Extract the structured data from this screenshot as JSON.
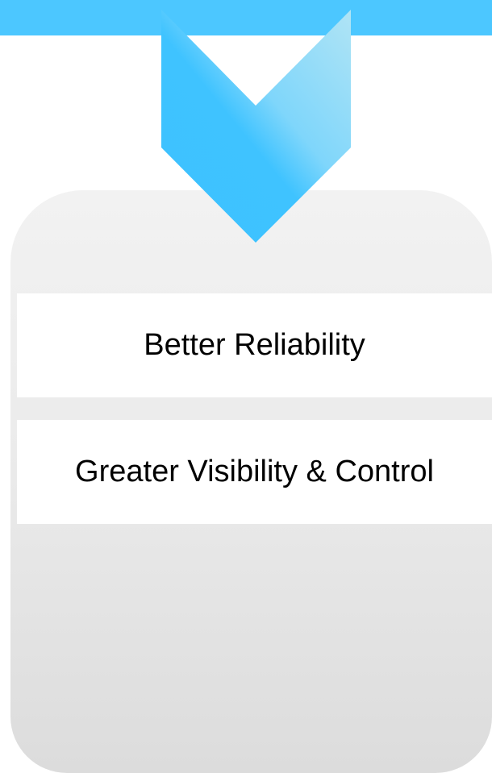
{
  "diagram": {
    "items": [
      {
        "label": "Better Reliability"
      },
      {
        "label": "Greater Visibility & Control"
      }
    ]
  },
  "colors": {
    "accent": "#4cc7ff",
    "chevron_light": "#a8e2f7",
    "card_top": "#f2f2f2",
    "card_bottom": "#dcdcdc",
    "band": "#ffffff",
    "text": "#000000"
  }
}
